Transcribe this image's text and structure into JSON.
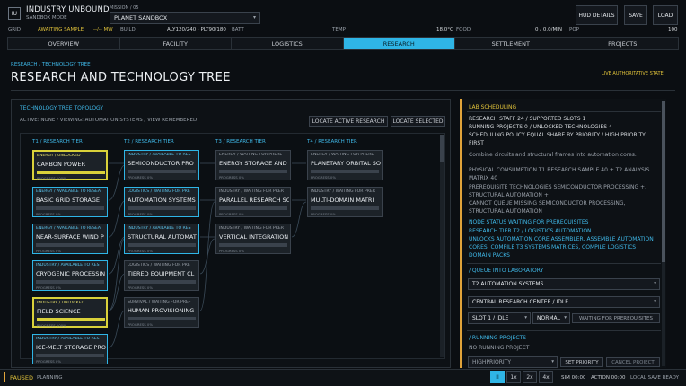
{
  "header": {
    "logo": "IU",
    "title": "INDUSTRY UNBOUND",
    "subtitle": "SANDBOX MODE",
    "mission_label": "MISSION / 05",
    "mission_value": "PLANET SANDBOX",
    "hud_details": "HUD DETAILS",
    "save": "SAVE",
    "load": "LOAD"
  },
  "status": {
    "grid_label": "GRID",
    "grid_value": "AWAITING SAMPLE",
    "grid_unit": "--/-- MW",
    "build_label": "BUILD",
    "build_value": "ALY120/240 · PLT90/180",
    "batt_label": "BATT",
    "temp_label": "TEMP",
    "temp_value": "18.0°C",
    "food_label": "FOOD",
    "food_value": "0 / 0.0/MIN",
    "pop_label": "POP",
    "pop_value": "100"
  },
  "tabs": [
    "OVERVIEW",
    "FACILITY",
    "LOGISTICS",
    "RESEARCH",
    "SETTLEMENT",
    "PROJECTS"
  ],
  "page": {
    "breadcrumb": "RESEARCH / TECHNOLOGY TREE",
    "title": "RESEARCH AND TECHNOLOGY TREE",
    "live_state": "LIVE AUTHORITATIVE STATE"
  },
  "tree": {
    "title": "TECHNOLOGY TREE TOPOLOGY",
    "meta": "ACTIVE: NONE  /  VIEWING: AUTOMATION SYSTEMS  /  VIEW REMEMBERED",
    "locate_active": "LOCATE ACTIVE RESEARCH",
    "locate_selected": "LOCATE SELECTED",
    "tiers": [
      "T1 / RESEARCH TIER",
      "T2 / RESEARCH TIER",
      "T3 / RESEARCH TIER",
      "T4 / RESEARCH TIER"
    ],
    "cards": [
      {
        "status": "ENERGY / UNLOCKED",
        "name": "CARBON POWER",
        "progress": "PROGRESS 100%",
        "style": "yellow",
        "fill": 1.0
      },
      {
        "status": "ENERGY / AVAILABLE TO RESEA",
        "name": "BASIC GRID STORAGE",
        "progress": "PROGRESS 0%",
        "style": "cyan",
        "fill": 0
      },
      {
        "status": "ENERGY / AVAILABLE TO RESEA",
        "name": "NEAR-SURFACE WIND P",
        "progress": "PROGRESS 0%",
        "style": "cyan",
        "fill": 0
      },
      {
        "status": "INDUSTRY / AVAILABLE TO RES",
        "name": "CRYOGENIC PROCESSIN",
        "progress": "PROGRESS 0%",
        "style": "cyan",
        "fill": 0
      },
      {
        "status": "INDUSTRY / UNLOCKED",
        "name": "FIELD SCIENCE",
        "progress": "PROGRESS 100%",
        "style": "yellow",
        "fill": 1.0
      },
      {
        "status": "INDUSTRY / AVAILABLE TO RES",
        "name": "ICE-MELT STORAGE PRO",
        "progress": "PROGRESS 0%",
        "style": "cyan",
        "fill": 0
      },
      {
        "status": "INDUSTRY / AVAILABLE TO RES",
        "name": "SEMICONDUCTOR PRO",
        "progress": "PROGRESS 0%",
        "style": "cyan",
        "fill": 0
      },
      {
        "status": "LOGISTICS / WAITING FOR PRE",
        "name": "AUTOMATION SYSTEMS",
        "progress": "PROGRESS 0%",
        "style": "cyan",
        "fill": 0
      },
      {
        "status": "INDUSTRY / AVAILABLE TO RES",
        "name": "STRUCTURAL AUTOMAT",
        "progress": "PROGRESS 0%",
        "style": "cyan",
        "fill": 0
      },
      {
        "status": "LOGISTICS / WAITING FOR PRE",
        "name": "TIERED EQUIPMENT CL",
        "progress": "PROGRESS 0%",
        "style": "grey",
        "fill": 0
      },
      {
        "status": "SURVIVAL / WAITING FOR PREF",
        "name": "HUMAN PROVISIONING",
        "progress": "PROGRESS 0%",
        "style": "grey",
        "fill": 0
      },
      {
        "status": "ENERGY / WAITING FOR PRERE",
        "name": "ENERGY STORAGE AND",
        "progress": "PROGRESS 0%",
        "style": "grey",
        "fill": 0
      },
      {
        "status": "INDUSTRY / WAITING FOR PRER",
        "name": "PARALLEL RESEARCH SC",
        "progress": "PROGRESS 0%",
        "style": "grey",
        "fill": 0
      },
      {
        "status": "INDUSTRY / WAITING FOR PRER",
        "name": "VERTICAL INTEGRATION",
        "progress": "PROGRESS 0%",
        "style": "grey",
        "fill": 0
      },
      {
        "status": "ENERGY / WAITING FOR PRERE",
        "name": "PLANETARY ORBITAL SO",
        "progress": "PROGRESS 0%",
        "style": "grey",
        "fill": 0
      },
      {
        "status": "INDUSTRY / WAITING FOR PRER",
        "name": "MULTI-DOMAIN MATRI",
        "progress": "PROGRESS 0%",
        "style": "grey",
        "fill": 0
      }
    ]
  },
  "lab": {
    "title": "LAB SCHEDULING",
    "lines": [
      "RESEARCH STAFF   24  /  SUPPORTED SLOTS 1",
      "RUNNING PROJECTS    0  /  UNLOCKED TECHNOLOGIES 4",
      "SCHEDULING POLICY   EQUAL SHARE BY PRIORITY  /  HIGH PRIORITY",
      "FIRST",
      "Combine circuits and structural frames into automation cores.",
      "PHYSICAL CONSUMPTION    T1 RESEARCH SAMPLE 40  +  T2 ANALYSIS",
      "MATRIX 40",
      "PREREQUISITE TECHNOLOGIES    SEMICONDUCTOR PROCESSING +,",
      "STRUCTURAL AUTOMATION +",
      "CANNOT QUEUE    MISSING SEMICONDUCTOR PROCESSING,",
      "STRUCTURAL AUTOMATION",
      "NODE STATUS    WAITING FOR PREREQUISITES",
      "RESEARCH TIER    T2 / LOGISTICS AUTOMATION",
      "UNLOCKS    AUTOMATION CORE ASSEMBLER,  ASSEMBLE AUTOMATION",
      "CORES,  COMPILE T3 SYSTEMS MATRICES,  COMPILE LOGISTICS",
      "DOMAIN PACKS"
    ],
    "queue_title": "/  QUEUE INTO LABORATORY",
    "queue_tech": "T2  AUTOMATION SYSTEMS",
    "queue_lab": "CENTRAL RESEARCH CENTER  /  IDLE",
    "queue_slot": "SLOT 1 / IDLE",
    "queue_priority": "NORMAL",
    "queue_status": "WAITING FOR PREREQUISITES",
    "running_title": "/  RUNNING PROJECTS",
    "running_empty": "NO RUNNING PROJECT",
    "highpriority": "HIGHPRIORITY",
    "set_priority": "SET PRIORITY",
    "cancel_project": "CANCEL PROJECT"
  },
  "bottom": {
    "paused": "PAUSED",
    "planning": "PLANNING",
    "speeds": [
      "II",
      "1x",
      "2x",
      "4x"
    ],
    "sim": "SIM 00:00",
    "action": "ACTION 00:00",
    "save_state": "LOCAL SAVE READY"
  },
  "colors": {
    "accent": "#2fb5e6",
    "unlocked": "#d9d13a",
    "warning": "#e0a33a"
  }
}
